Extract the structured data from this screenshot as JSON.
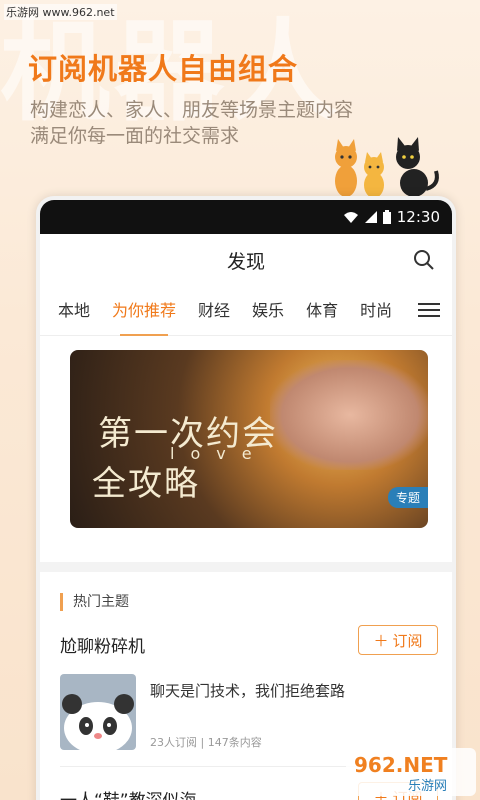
{
  "watermark": {
    "site": "乐游网 www.962.net",
    "bg_text": "机器人"
  },
  "hero": {
    "headline": "订阅机器人自由组合",
    "line1": "构建恋人、家人、朋友等场景主题内容",
    "line2": "满足你每一面的社交需求"
  },
  "status": {
    "time": "12:30"
  },
  "appbar": {
    "title": "发现",
    "search_icon": "search-icon"
  },
  "tabs": [
    {
      "label": "本地"
    },
    {
      "label": "为你推荐"
    },
    {
      "label": "财经"
    },
    {
      "label": "娱乐"
    },
    {
      "label": "体育"
    },
    {
      "label": "时尚"
    }
  ],
  "banner": {
    "line1": "第一次约会",
    "love": "love",
    "line2": "全攻略",
    "badge": "专题"
  },
  "section": {
    "title": "热门主题"
  },
  "topics": [
    {
      "name": "尬聊粉碎机",
      "subscribe": "订阅",
      "article_title": "聊天是门技术，我们拒绝套路",
      "meta": "23人订阅 | 147条内容"
    },
    {
      "name": "一人“鞋”教深似海",
      "subscribe": "订阅"
    }
  ],
  "brand_mark": {
    "text_top": "962.NET",
    "text_bottom": "乐游网"
  },
  "colors": {
    "accent": "#f0791a",
    "accent_light": "#f0a050"
  }
}
